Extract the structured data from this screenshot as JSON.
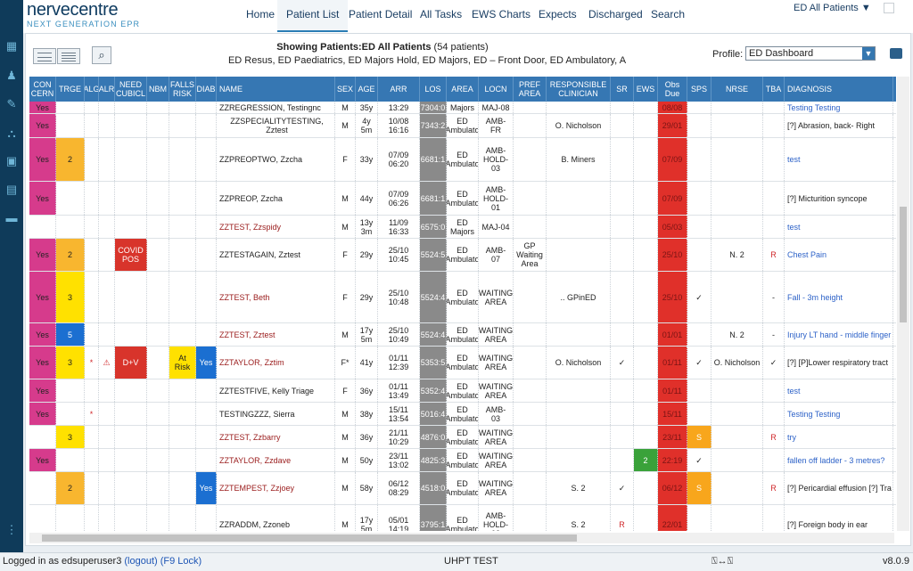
{
  "app": {
    "logo_title": "nervecentre",
    "logo_subtitle": "NEXT GENERATION EPR"
  },
  "nav": {
    "items": [
      "Home",
      "Patient List",
      "Patient Detail",
      "All Tasks",
      "EWS Charts",
      "Expects",
      "Discharged",
      "Search"
    ],
    "active": "Patient List",
    "location": "ED All Patients ▼"
  },
  "header": {
    "showing_label": "Showing Patients:",
    "showing_list": "ED All Patients",
    "showing_count": "(54 patients)",
    "sublist": "ED Resus, ED Paediatrics, ED Majors Hold, ED Majors, ED – Front Door, ED Ambulatory, A",
    "profile_label": "Profile:",
    "profile_value": "ED Dashboard"
  },
  "table": {
    "columns": [
      "CON CERN",
      "TRGE",
      "ALG",
      "ALR",
      "NEED CUBICL",
      "NBM",
      "FALLS RISK",
      "DIAB",
      "NAME",
      "SEX",
      "AGE",
      "ARR",
      "LOS",
      "AREA",
      "LOCN",
      "PREF AREA",
      "RESPONSIBLE CLINICIAN",
      "SR",
      "EWS",
      "Obs Due",
      "SPS",
      "NRSE",
      "TBA",
      "DIAGNOSIS"
    ],
    "rows": [
      {
        "concern": "Yes",
        "trge": "",
        "alg": "",
        "alr": "",
        "cub": "",
        "nbm": "",
        "falls": "",
        "diab": "",
        "name": "ZZREGRESSION, Testingnc",
        "sex": "M",
        "age": "35y",
        "arr": "13:29",
        "los": "7304:0",
        "area": "Majors",
        "locn": "MAJ-08",
        "pref": "",
        "clin": "",
        "sr": "",
        "ews": "",
        "obs": "08/08",
        "sps": "",
        "nrse": "",
        "tba": "",
        "diag": "Testing Testing"
      },
      {
        "concern": "Yes",
        "trge": "",
        "alg": "",
        "alr": "",
        "cub": "",
        "nbm": "",
        "falls": "",
        "diab": "",
        "name": "ZZSPECIALITYTESTING, Zztest",
        "sex": "M",
        "age": "4y\n5m",
        "arr": "10/08\n16:16",
        "los": "7343:2",
        "area": "ED\nAmbulato",
        "locn": "AMB-\nFR",
        "pref": "",
        "clin": "O. Nicholson",
        "sr": "",
        "ews": "",
        "obs": "29/01",
        "sps": "",
        "nrse": "",
        "tba": "",
        "diag": "[?] Abrasion, back- Right"
      },
      {
        "concern": "Yes",
        "trge": "2",
        "alg": "",
        "alr": "",
        "cub": "",
        "nbm": "",
        "falls": "",
        "diab": "",
        "name": "ZZPREOPTWO, Zzcha",
        "sex": "F",
        "age": "33y",
        "arr": "07/09\n06:20",
        "los": "6681:1",
        "area": "ED\nAmbulato",
        "locn": "AMB-\nHOLD-\n03",
        "pref": "",
        "clin": "B. Miners",
        "sr": "",
        "ews": "",
        "obs": "07/09",
        "sps": "",
        "nrse": "",
        "tba": "",
        "diag": "test"
      },
      {
        "concern": "Yes",
        "trge": "",
        "alg": "",
        "alr": "",
        "cub": "",
        "nbm": "",
        "falls": "",
        "diab": "",
        "name": "ZZPREOP, Zzcha",
        "sex": "M",
        "age": "44y",
        "arr": "07/09\n06:26",
        "los": "6681:1",
        "area": "ED\nAmbulato",
        "locn": "AMB-\nHOLD-\n01",
        "pref": "",
        "clin": "",
        "sr": "",
        "ews": "",
        "obs": "07/09",
        "sps": "",
        "nrse": "",
        "tba": "",
        "diag": "[?] Micturition syncope"
      },
      {
        "concern": "",
        "trge": "",
        "alg": "",
        "alr": "",
        "cub": "",
        "nbm": "",
        "falls": "",
        "diab": "",
        "name": "ZZTEST, Zzspidy",
        "sex": "M",
        "age": "13y\n3m",
        "arr": "11/09\n16:33",
        "los": "6575:0",
        "area": "ED\nMajors",
        "locn": "MAJ-04",
        "pref": "",
        "clin": "",
        "sr": "",
        "ews": "",
        "obs": "05/03",
        "sps": "",
        "nrse": "",
        "tba": "",
        "diag": "test"
      },
      {
        "concern": "Yes",
        "trge": "2",
        "alg": "",
        "alr": "",
        "cub": "COVID\nPOS",
        "nbm": "",
        "falls": "",
        "diab": "",
        "name": "ZZTESTAGAIN, Zztest",
        "sex": "F",
        "age": "29y",
        "arr": "25/10\n10:45",
        "los": "5524:5",
        "area": "ED\nAmbulato",
        "locn": "AMB-\n07",
        "pref": "GP\nWaiting\nArea",
        "clin": "",
        "sr": "",
        "ews": "",
        "obs": "25/10",
        "sps": "",
        "nrse": "N. 2",
        "tba": "R",
        "diag": "Chest Pain"
      },
      {
        "concern": "Yes",
        "trge": "3",
        "alg": "",
        "alr": "",
        "cub": "",
        "nbm": "",
        "falls": "",
        "diab": "",
        "name": "ZZTEST, Beth",
        "sex": "F",
        "age": "29y",
        "arr": "25/10\n10:48",
        "los": "5524:4",
        "area": "ED\nAmbulato",
        "locn": "WAITING\nAREA",
        "pref": "",
        "clin": ".. GPinED",
        "sr": "",
        "ews": "",
        "obs": "25/10",
        "sps": "✓",
        "nrse": "",
        "tba": "-",
        "diag": "Fall - 3m height"
      },
      {
        "concern": "Yes",
        "trge": "5",
        "alg": "",
        "alr": "",
        "cub": "",
        "nbm": "",
        "falls": "",
        "diab": "",
        "name": "ZZTEST, Zztest",
        "sex": "M",
        "age": "17y\n5m",
        "arr": "25/10\n10:49",
        "los": "5524:4",
        "area": "ED\nAmbulato",
        "locn": "WAITING\nAREA",
        "pref": "",
        "clin": "",
        "sr": "",
        "ews": "",
        "obs": "01/01",
        "sps": "",
        "nrse": "N. 2",
        "tba": "-",
        "diag": "Injury LT hand - middle finger"
      },
      {
        "concern": "Yes",
        "trge": "3",
        "alg": "*",
        "alr": "⚠",
        "cub": "D+V",
        "nbm": "",
        "falls": "At\nRisk",
        "diab": "Yes",
        "name": "ZZTAYLOR, Zztim",
        "sex": "F*",
        "age": "41y",
        "arr": "01/11\n12:39",
        "los": "5353:5",
        "area": "ED\nAmbulato",
        "locn": "WAITING\nAREA",
        "pref": "",
        "clin": "O. Nicholson",
        "sr": "✓",
        "ews": "",
        "obs": "01/11",
        "sps": "✓",
        "nrse": "O. Nicholson",
        "tba": "✓",
        "diag": "[?] [P]Lower respiratory tract"
      },
      {
        "concern": "Yes",
        "trge": "",
        "alg": "",
        "alr": "",
        "cub": "",
        "nbm": "",
        "falls": "",
        "diab": "",
        "name": "ZZTESTFIVE, Kelly Triage",
        "sex": "F",
        "age": "36y",
        "arr": "01/11\n13:49",
        "los": "5352:4",
        "area": "ED\nAmbulato",
        "locn": "WAITING\nAREA",
        "pref": "",
        "clin": "",
        "sr": "",
        "ews": "",
        "obs": "01/11",
        "sps": "",
        "nrse": "",
        "tba": "",
        "diag": "test"
      },
      {
        "concern": "Yes",
        "trge": "",
        "alg": "*",
        "alr": "",
        "cub": "",
        "nbm": "",
        "falls": "",
        "diab": "",
        "name": "TESTINGZZZ, Sierra",
        "sex": "M",
        "age": "38y",
        "arr": "15/11\n13:54",
        "los": "5016:4",
        "area": "ED\nAmbulato",
        "locn": "AMB-\n03",
        "pref": "",
        "clin": "",
        "sr": "",
        "ews": "",
        "obs": "15/11",
        "sps": "",
        "nrse": "",
        "tba": "",
        "diag": "Testing Testing"
      },
      {
        "concern": "",
        "trge": "3",
        "alg": "",
        "alr": "",
        "cub": "",
        "nbm": "",
        "falls": "",
        "diab": "",
        "name": "ZZTEST, Zzbarry",
        "sex": "M",
        "age": "36y",
        "arr": "21/11\n10:29",
        "los": "4876:0",
        "area": "ED\nAmbulato",
        "locn": "WAITING\nAREA",
        "pref": "",
        "clin": "",
        "sr": "",
        "ews": "",
        "obs": "23/11",
        "sps": "S",
        "nrse": "",
        "tba": "R",
        "diag": "try"
      },
      {
        "concern": "Yes",
        "trge": "",
        "alg": "",
        "alr": "",
        "cub": "",
        "nbm": "",
        "falls": "",
        "diab": "",
        "name": "ZZTAYLOR, Zzdave",
        "sex": "M",
        "age": "50y",
        "arr": "23/11\n13:02",
        "los": "4825:3",
        "area": "ED\nAmbulato",
        "locn": "WAITING\nAREA",
        "pref": "",
        "clin": "",
        "sr": "",
        "ews": "2",
        "obs": "22:19",
        "sps": "✓",
        "nrse": "",
        "tba": "",
        "diag": "fallen off ladder - 3 metres?"
      },
      {
        "concern": "",
        "trge": "2",
        "alg": "",
        "alr": "",
        "cub": "",
        "nbm": "",
        "falls": "",
        "diab": "Yes",
        "name": "ZZTEMPEST, Zzjoey",
        "sex": "M",
        "age": "58y",
        "arr": "06/12\n08:29",
        "los": "4518:0",
        "area": "ED\nAmbulato",
        "locn": "WAITING\nAREA",
        "pref": "",
        "clin": "S. 2",
        "sr": "✓",
        "ews": "",
        "obs": "06/12",
        "sps": "S",
        "nrse": "",
        "tba": "R",
        "diag": "[?] Pericardial effusion [?] Tra"
      },
      {
        "concern": "",
        "trge": "",
        "alg": "",
        "alr": "",
        "cub": "",
        "nbm": "",
        "falls": "",
        "diab": "",
        "name": "ZZRADDM, Zzoneb",
        "sex": "M",
        "age": "17y\n5m",
        "arr": "05/01\n14:19",
        "los": "3795:1",
        "area": "ED\nAmbulato",
        "locn": "AMB-\nHOLD-\n02",
        "pref": "",
        "clin": "S. 2",
        "sr": "R",
        "ews": "",
        "obs": "22/01",
        "sps": "",
        "nrse": "",
        "tba": "",
        "diag": "[?] Foreign body in ear"
      }
    ]
  },
  "footer": {
    "logged_in": "Logged in as edsuperuser3",
    "logout": "(logout)",
    "lock": "(F9 Lock)",
    "center": "UHPT TEST",
    "version": "v8.0.9",
    "icon": "⍂↔⍂"
  },
  "colors": {
    "concern": "#d63b8c",
    "trge2": "#f8b62f",
    "trge3": "#ffe100",
    "trge5": "#1b6fd1",
    "covid": "#d8342b",
    "falls": "#ffe100",
    "diab": "#1b6fd1",
    "obs": "#e0302a",
    "ews2": "#3aa23a",
    "sps": "#f8a61c"
  },
  "icons": [
    "menu-icon",
    "patients-icon",
    "tasks-icon",
    "network-icon",
    "archive-icon",
    "clipboard-icon",
    "bed-icon",
    "more-icon",
    "printer-icon",
    "search-icon",
    "window-icon"
  ]
}
